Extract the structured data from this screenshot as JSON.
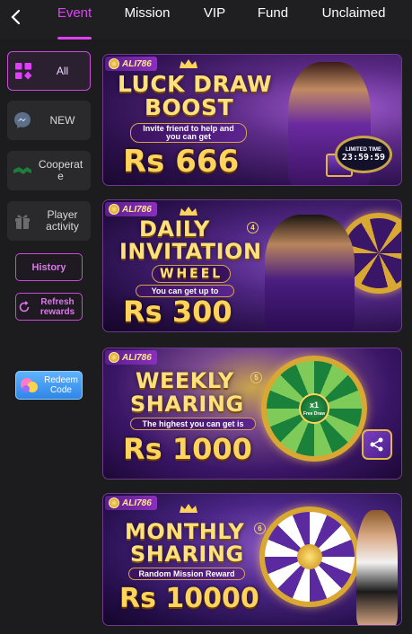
{
  "tabs": [
    {
      "label": "Event",
      "active": true
    },
    {
      "label": "Mission",
      "active": false
    },
    {
      "label": "VIP",
      "active": false
    },
    {
      "label": "Fund",
      "active": false
    },
    {
      "label": "Unclaimed",
      "active": false
    }
  ],
  "sidebar": {
    "items": [
      {
        "label": "All",
        "icon": "grid-icon",
        "active": true
      },
      {
        "label": "NEW",
        "icon": "messenger-icon",
        "active": false
      },
      {
        "label": "Cooperate",
        "icon": "handshake-icon",
        "active": false
      },
      {
        "label": "Player activity",
        "icon": "gift-icon",
        "active": false
      }
    ],
    "history_label": "History",
    "refresh_label": "Refresh rewards",
    "redeem_label": "Redeem Code"
  },
  "banners": [
    {
      "brand": "ALI786",
      "title_line1": "LUCK DRAW",
      "title_line2": "BOOST",
      "subtitle": "Invite friend to help and you can get",
      "amount": "Rs 666",
      "timer_label": "LIMITED TIME",
      "timer_value": "23:59:59"
    },
    {
      "brand": "ALI786",
      "title_line1": "DAILY",
      "title_line2": "INVITATION",
      "title_line3": "WHEEL",
      "badge": "4",
      "subtitle": "You can get up to",
      "amount": "Rs 300"
    },
    {
      "brand": "ALI786",
      "title_line1": "WEEKLY",
      "title_line2": "SHARING",
      "badge": "5",
      "subtitle": "The highest you can get is",
      "amount": "Rs 1000",
      "wheel_center": "x1",
      "wheel_center_sub": "Free Draw"
    },
    {
      "brand": "ALI786",
      "title_line1": "MONTHLY",
      "title_line2": "SHARING",
      "badge": "6",
      "subtitle": "Random Mission Reward",
      "amount": "Rs 10000"
    }
  ],
  "colors": {
    "accent": "#e040fb",
    "background": "#1c1c1e",
    "gold": "#ffd45a"
  }
}
